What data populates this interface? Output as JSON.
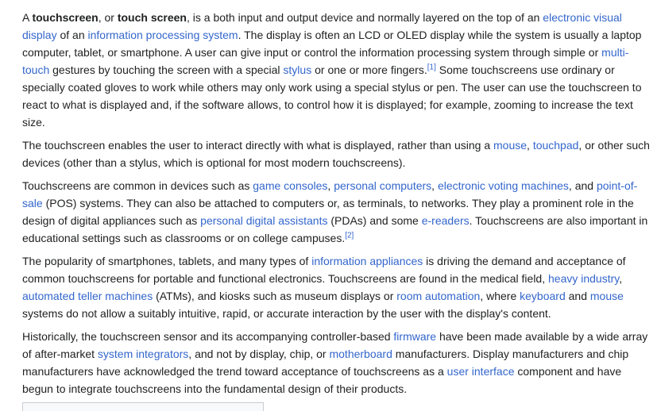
{
  "paragraphs": [
    [
      {
        "t": "A "
      },
      {
        "t": "touchscreen",
        "bold": true
      },
      {
        "t": ", or "
      },
      {
        "t": "touch screen",
        "bold": true
      },
      {
        "t": ", is a both input and output device and normally layered on the top of an "
      },
      {
        "t": "electronic visual display",
        "link": true
      },
      {
        "t": " of an "
      },
      {
        "t": "information processing system",
        "link": true
      },
      {
        "t": ". The display is often an LCD or OLED display while the system is usually a laptop computer, tablet, or smartphone. A user can give input or control the information processing system through simple or "
      },
      {
        "t": "multi-touch",
        "link": true
      },
      {
        "t": " gestures by touching the screen with a special "
      },
      {
        "t": "stylus",
        "link": true
      },
      {
        "t": " or one or more fingers."
      },
      {
        "t": "[1]",
        "ref": true
      },
      {
        "t": " Some touchscreens use ordinary or specially coated gloves to work while others may only work using a special stylus or pen. The user can use the touchscreen to react to what is displayed and, if the software allows, to control how it is displayed; for example, zooming to increase the text size."
      }
    ],
    [
      {
        "t": "The touchscreen enables the user to interact directly with what is displayed, rather than using a "
      },
      {
        "t": "mouse",
        "link": true
      },
      {
        "t": ", "
      },
      {
        "t": "touchpad",
        "link": true
      },
      {
        "t": ", or other such devices (other than a stylus, which is optional for most modern touchscreens)."
      }
    ],
    [
      {
        "t": "Touchscreens are common in devices such as "
      },
      {
        "t": "game consoles",
        "link": true
      },
      {
        "t": ", "
      },
      {
        "t": "personal computers",
        "link": true
      },
      {
        "t": ", "
      },
      {
        "t": "electronic voting machines",
        "link": true
      },
      {
        "t": ", and "
      },
      {
        "t": "point-of-sale",
        "link": true
      },
      {
        "t": " (POS) systems. They can also be attached to computers or, as terminals, to networks. They play a prominent role in the design of digital appliances such as "
      },
      {
        "t": "personal digital assistants",
        "link": true
      },
      {
        "t": " (PDAs) and some "
      },
      {
        "t": "e-readers",
        "link": true
      },
      {
        "t": ". Touchscreens are also important in educational settings such as classrooms or on college campuses."
      },
      {
        "t": "[2]",
        "ref": true
      }
    ],
    [
      {
        "t": "The popularity of smartphones, tablets, and many types of "
      },
      {
        "t": "information appliances",
        "link": true
      },
      {
        "t": " is driving the demand and acceptance of common touchscreens for portable and functional electronics. Touchscreens are found in the medical field, "
      },
      {
        "t": "heavy industry",
        "link": true
      },
      {
        "t": ", "
      },
      {
        "t": "automated teller machines",
        "link": true
      },
      {
        "t": " (ATMs), and kiosks such as museum displays or "
      },
      {
        "t": "room automation",
        "link": true
      },
      {
        "t": ", where "
      },
      {
        "t": "keyboard",
        "link": true
      },
      {
        "t": " and "
      },
      {
        "t": "mouse",
        "link": true
      },
      {
        "t": " systems do not allow a suitably intuitive, rapid, or accurate interaction by the user with the display's content."
      }
    ],
    [
      {
        "t": "Historically, the touchscreen sensor and its accompanying controller-based "
      },
      {
        "t": "firmware",
        "link": true
      },
      {
        "t": " have been made available by a wide array of after-market "
      },
      {
        "t": "system integrators",
        "link": true
      },
      {
        "t": ", and not by display, chip, or "
      },
      {
        "t": "motherboard",
        "link": true
      },
      {
        "t": " manufacturers. Display manufacturers and chip manufacturers have acknowledged the trend toward acceptance of touchscreens as a "
      },
      {
        "t": "user interface",
        "link": true
      },
      {
        "t": " component and have begun to integrate touchscreens into the fundamental design of their products."
      }
    ]
  ],
  "colors": {
    "text": "#202122",
    "link": "#3366cc",
    "border": "#c8ccd1",
    "background": "#ffffff"
  }
}
